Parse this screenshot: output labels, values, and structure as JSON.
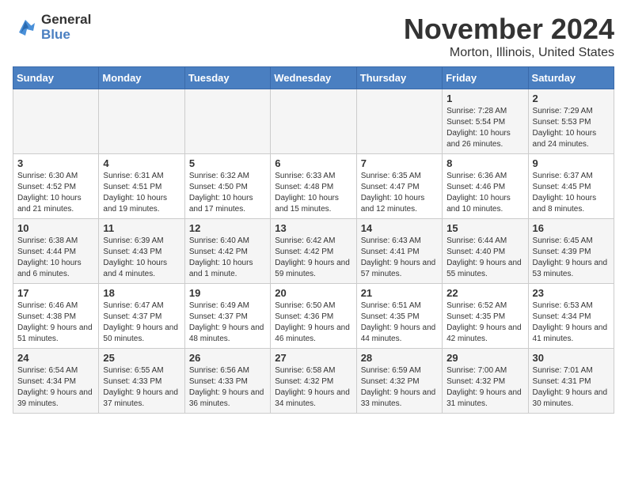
{
  "logo": {
    "general": "General",
    "blue": "Blue"
  },
  "title": "November 2024",
  "subtitle": "Morton, Illinois, United States",
  "days_of_week": [
    "Sunday",
    "Monday",
    "Tuesday",
    "Wednesday",
    "Thursday",
    "Friday",
    "Saturday"
  ],
  "weeks": [
    [
      {
        "day": "",
        "info": ""
      },
      {
        "day": "",
        "info": ""
      },
      {
        "day": "",
        "info": ""
      },
      {
        "day": "",
        "info": ""
      },
      {
        "day": "",
        "info": ""
      },
      {
        "day": "1",
        "info": "Sunrise: 7:28 AM\nSunset: 5:54 PM\nDaylight: 10 hours and 26 minutes."
      },
      {
        "day": "2",
        "info": "Sunrise: 7:29 AM\nSunset: 5:53 PM\nDaylight: 10 hours and 24 minutes."
      }
    ],
    [
      {
        "day": "3",
        "info": "Sunrise: 6:30 AM\nSunset: 4:52 PM\nDaylight: 10 hours and 21 minutes."
      },
      {
        "day": "4",
        "info": "Sunrise: 6:31 AM\nSunset: 4:51 PM\nDaylight: 10 hours and 19 minutes."
      },
      {
        "day": "5",
        "info": "Sunrise: 6:32 AM\nSunset: 4:50 PM\nDaylight: 10 hours and 17 minutes."
      },
      {
        "day": "6",
        "info": "Sunrise: 6:33 AM\nSunset: 4:48 PM\nDaylight: 10 hours and 15 minutes."
      },
      {
        "day": "7",
        "info": "Sunrise: 6:35 AM\nSunset: 4:47 PM\nDaylight: 10 hours and 12 minutes."
      },
      {
        "day": "8",
        "info": "Sunrise: 6:36 AM\nSunset: 4:46 PM\nDaylight: 10 hours and 10 minutes."
      },
      {
        "day": "9",
        "info": "Sunrise: 6:37 AM\nSunset: 4:45 PM\nDaylight: 10 hours and 8 minutes."
      }
    ],
    [
      {
        "day": "10",
        "info": "Sunrise: 6:38 AM\nSunset: 4:44 PM\nDaylight: 10 hours and 6 minutes."
      },
      {
        "day": "11",
        "info": "Sunrise: 6:39 AM\nSunset: 4:43 PM\nDaylight: 10 hours and 4 minutes."
      },
      {
        "day": "12",
        "info": "Sunrise: 6:40 AM\nSunset: 4:42 PM\nDaylight: 10 hours and 1 minute."
      },
      {
        "day": "13",
        "info": "Sunrise: 6:42 AM\nSunset: 4:42 PM\nDaylight: 9 hours and 59 minutes."
      },
      {
        "day": "14",
        "info": "Sunrise: 6:43 AM\nSunset: 4:41 PM\nDaylight: 9 hours and 57 minutes."
      },
      {
        "day": "15",
        "info": "Sunrise: 6:44 AM\nSunset: 4:40 PM\nDaylight: 9 hours and 55 minutes."
      },
      {
        "day": "16",
        "info": "Sunrise: 6:45 AM\nSunset: 4:39 PM\nDaylight: 9 hours and 53 minutes."
      }
    ],
    [
      {
        "day": "17",
        "info": "Sunrise: 6:46 AM\nSunset: 4:38 PM\nDaylight: 9 hours and 51 minutes."
      },
      {
        "day": "18",
        "info": "Sunrise: 6:47 AM\nSunset: 4:37 PM\nDaylight: 9 hours and 50 minutes."
      },
      {
        "day": "19",
        "info": "Sunrise: 6:49 AM\nSunset: 4:37 PM\nDaylight: 9 hours and 48 minutes."
      },
      {
        "day": "20",
        "info": "Sunrise: 6:50 AM\nSunset: 4:36 PM\nDaylight: 9 hours and 46 minutes."
      },
      {
        "day": "21",
        "info": "Sunrise: 6:51 AM\nSunset: 4:35 PM\nDaylight: 9 hours and 44 minutes."
      },
      {
        "day": "22",
        "info": "Sunrise: 6:52 AM\nSunset: 4:35 PM\nDaylight: 9 hours and 42 minutes."
      },
      {
        "day": "23",
        "info": "Sunrise: 6:53 AM\nSunset: 4:34 PM\nDaylight: 9 hours and 41 minutes."
      }
    ],
    [
      {
        "day": "24",
        "info": "Sunrise: 6:54 AM\nSunset: 4:34 PM\nDaylight: 9 hours and 39 minutes."
      },
      {
        "day": "25",
        "info": "Sunrise: 6:55 AM\nSunset: 4:33 PM\nDaylight: 9 hours and 37 minutes."
      },
      {
        "day": "26",
        "info": "Sunrise: 6:56 AM\nSunset: 4:33 PM\nDaylight: 9 hours and 36 minutes."
      },
      {
        "day": "27",
        "info": "Sunrise: 6:58 AM\nSunset: 4:32 PM\nDaylight: 9 hours and 34 minutes."
      },
      {
        "day": "28",
        "info": "Sunrise: 6:59 AM\nSunset: 4:32 PM\nDaylight: 9 hours and 33 minutes."
      },
      {
        "day": "29",
        "info": "Sunrise: 7:00 AM\nSunset: 4:32 PM\nDaylight: 9 hours and 31 minutes."
      },
      {
        "day": "30",
        "info": "Sunrise: 7:01 AM\nSunset: 4:31 PM\nDaylight: 9 hours and 30 minutes."
      }
    ]
  ]
}
